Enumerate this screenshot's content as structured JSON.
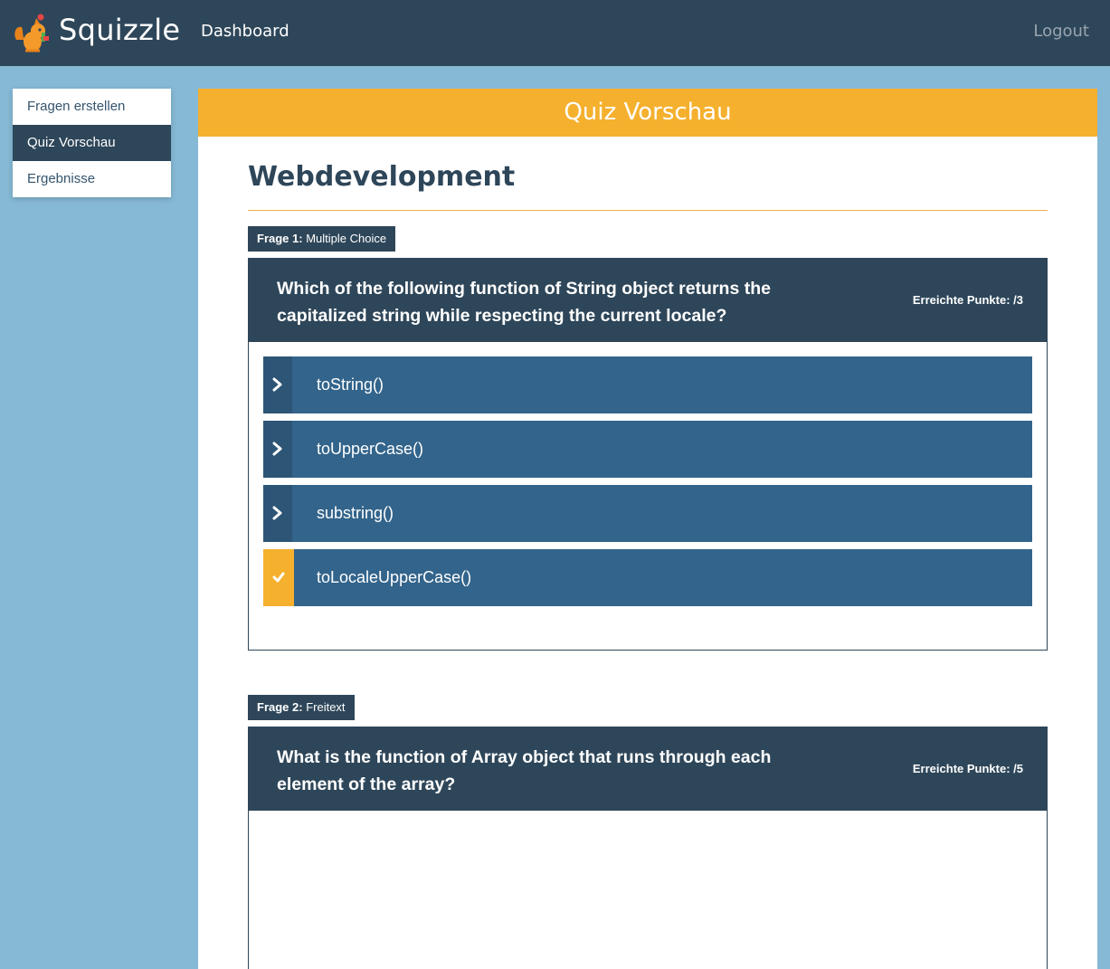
{
  "navbar": {
    "brand": "Squizzle",
    "dashboard_label": "Dashboard",
    "logout_label": "Logout"
  },
  "sidebar": {
    "items": [
      {
        "label": "Fragen erstellen",
        "active": false
      },
      {
        "label": "Quiz Vorschau",
        "active": true
      },
      {
        "label": "Ergebnisse",
        "active": false
      }
    ]
  },
  "main": {
    "header": "Quiz Vorschau",
    "quiz_title": "Webdevelopment",
    "questions": [
      {
        "badge_number": "Frage 1:",
        "badge_type": "Multiple Choice",
        "text": "Which of the following function of String object returns the capitalized string while respecting the current locale?",
        "points": "Erreichte Punkte: /3",
        "answers": [
          {
            "label": "toString()",
            "selected": false
          },
          {
            "label": "toUpperCase()",
            "selected": false
          },
          {
            "label": "substring()",
            "selected": false
          },
          {
            "label": "toLocaleUpperCase()",
            "selected": true
          }
        ]
      },
      {
        "badge_number": "Frage 2:",
        "badge_type": "Freitext",
        "text": "What is the function of Array object that runs through each element of the array?",
        "points": "Erreichte Punkte: /5"
      }
    ]
  },
  "colors": {
    "navbar": "#2e4659",
    "background": "#86b9d6",
    "accent": "#f5b02e",
    "answer": "#33648b"
  },
  "icons": {
    "logo": "squirrel-logo-icon",
    "unselected_marker": "chevron-right-icon",
    "selected_marker": "checkmark-icon"
  }
}
